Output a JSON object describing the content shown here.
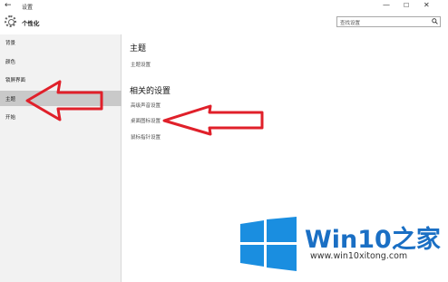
{
  "window": {
    "back_glyph": "←",
    "title": "设置",
    "minimize_glyph": "—",
    "maximize_glyph": "☐",
    "close_glyph": "✕"
  },
  "header": {
    "icon": "gear-icon",
    "title": "个性化",
    "search_placeholder": "查找设置"
  },
  "sidebar": {
    "items": [
      {
        "label": "背景",
        "selected": false
      },
      {
        "label": "颜色",
        "selected": false
      },
      {
        "label": "锁屏界面",
        "selected": false
      },
      {
        "label": "主题",
        "selected": true
      },
      {
        "label": "开始",
        "selected": false
      }
    ]
  },
  "main": {
    "theme_section": {
      "title": "主题",
      "link": "主题设置"
    },
    "related_section": {
      "title": "相关的设置",
      "links": [
        "高级声音设置",
        "桌面图标设置",
        "鼠标指针设置"
      ]
    }
  },
  "annotations": {
    "arrow_color": "#e0202a",
    "targets": [
      "sidebar-item-theme",
      "desktop-icon-settings-link"
    ]
  },
  "watermark": {
    "logo": "windows-logo",
    "brand": "Win10之家",
    "url": "www.win10xitong.com",
    "logo_color": "#1a8ee0"
  }
}
